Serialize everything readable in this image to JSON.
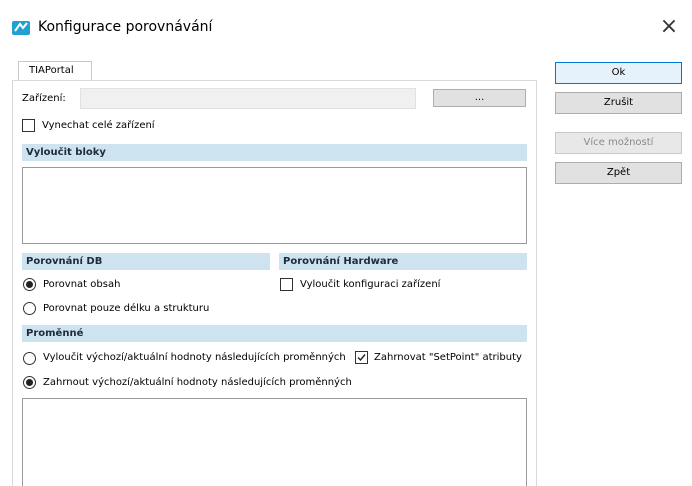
{
  "window": {
    "title": "Konfigurace porovnávání",
    "close_glyph": "×",
    "icon": "tia-portal-app-icon"
  },
  "tabs": [
    {
      "label": "TIAPortal"
    }
  ],
  "device": {
    "label": "Zařízení:",
    "value": "",
    "browse_label": "..."
  },
  "skip_device": {
    "label": "Vynechat celé zařízení",
    "checked": false
  },
  "exclude_blocks": {
    "header": "Vyloučit bloky"
  },
  "db_compare": {
    "header": "Porovnání DB",
    "options": [
      {
        "label": "Porovnat obsah",
        "selected": true
      },
      {
        "label": "Porovnat pouze délku a strukturu",
        "selected": false
      }
    ]
  },
  "hw_compare": {
    "header": "Porovnání Hardware",
    "exclude_device_config": {
      "label": "Vyloučit konfiguraci zařízení",
      "checked": false
    }
  },
  "variables": {
    "header": "Proměnné",
    "exclude_option": {
      "label": "Vyloučit výchozí/aktuální hodnoty následujících proměnných",
      "selected": false
    },
    "include_option": {
      "label": "Zahrnout výchozí/aktuální hodnoty následujících proměnných",
      "selected": true
    },
    "setpoint": {
      "label": "Zahrnovat \"SetPoint\" atributy",
      "checked": true
    }
  },
  "buttons": {
    "ok": "Ok",
    "cancel": "Zrušit",
    "more": "Více možností",
    "back": "Zpět"
  },
  "colors": {
    "header_bg": "#cde3f0",
    "primary_border": "#0078d7"
  }
}
